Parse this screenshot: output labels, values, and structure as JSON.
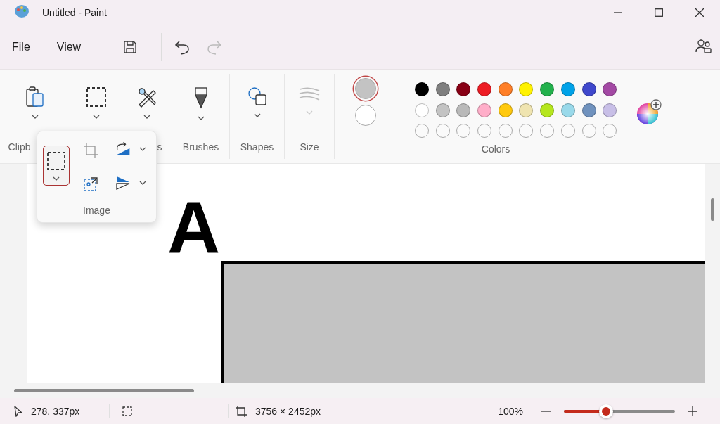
{
  "window": {
    "title": "Untitled - Paint"
  },
  "menu": [
    {
      "label": "File"
    },
    {
      "label": "View"
    }
  ],
  "quick_actions": [
    {
      "kind": "save",
      "disabled": false
    },
    {
      "kind": "undo",
      "disabled": false
    },
    {
      "kind": "redo",
      "disabled": true
    }
  ],
  "ribbon": {
    "groups": [
      {
        "kind": "clipboard",
        "label": "Clipb",
        "disabled": false
      },
      {
        "kind": "image",
        "disabled": false
      },
      {
        "kind": "tools",
        "label": "s",
        "disabled": false
      },
      {
        "kind": "brushes",
        "label": "Brushes",
        "disabled": false
      },
      {
        "kind": "shapes",
        "label": "Shapes",
        "disabled": false
      },
      {
        "kind": "size",
        "label": "Size",
        "disabled": true
      }
    ]
  },
  "image_flyout": {
    "label": "Image",
    "tools": [
      {
        "kind": "select",
        "selected": true,
        "disabled": false
      },
      {
        "kind": "crop",
        "selected": false,
        "disabled": true
      },
      {
        "kind": "rotate",
        "selected": false,
        "disabled": false
      },
      {
        "kind": "resize",
        "selected": false,
        "disabled": false
      },
      {
        "kind": "flip",
        "selected": false,
        "disabled": false
      }
    ]
  },
  "colors": {
    "label": "Colors",
    "primary": {
      "color": "#c3c3c3",
      "selected": true
    },
    "secondary": {
      "color": "#ffffff",
      "selected": false
    },
    "palette": [
      [
        {
          "kind": "color",
          "color": "#000000"
        },
        {
          "kind": "color",
          "color": "#7f7f7f"
        },
        {
          "kind": "color",
          "color": "#880015"
        },
        {
          "kind": "color",
          "color": "#ed1c24"
        },
        {
          "kind": "color",
          "color": "#ff7f27"
        },
        {
          "kind": "color",
          "color": "#fff200"
        },
        {
          "kind": "color",
          "color": "#22b14c"
        },
        {
          "kind": "color",
          "color": "#00a2e8"
        },
        {
          "kind": "color",
          "color": "#3f48cc"
        },
        {
          "kind": "color",
          "color": "#a349a4"
        }
      ],
      [
        {
          "kind": "color",
          "color": "#ffffff"
        },
        {
          "kind": "color",
          "color": "#c3c3c3"
        },
        {
          "kind": "color",
          "color": "#b9b9b9"
        },
        {
          "kind": "color",
          "color": "#ffaec9"
        },
        {
          "kind": "color",
          "color": "#ffc90e"
        },
        {
          "kind": "color",
          "color": "#efe4b0"
        },
        {
          "kind": "color",
          "color": "#b5e61d"
        },
        {
          "kind": "color",
          "color": "#99d9ea"
        },
        {
          "kind": "color",
          "color": "#7092be"
        },
        {
          "kind": "color",
          "color": "#c8bfe7"
        }
      ],
      [
        {
          "kind": "empty"
        },
        {
          "kind": "empty"
        },
        {
          "kind": "empty"
        },
        {
          "kind": "empty"
        },
        {
          "kind": "empty"
        },
        {
          "kind": "empty"
        },
        {
          "kind": "empty"
        },
        {
          "kind": "empty"
        },
        {
          "kind": "empty"
        },
        {
          "kind": "empty"
        }
      ]
    ]
  },
  "canvas": {
    "text": "A"
  },
  "status_bar": {
    "cursor": "278, 337px",
    "canvas_size": "3756 × 2452px",
    "zoom": "100%",
    "zoom_slider": {
      "level": 0.38
    }
  }
}
